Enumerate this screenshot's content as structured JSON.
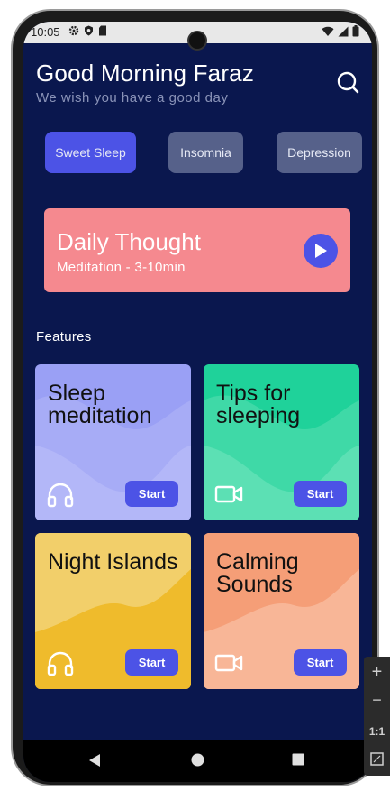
{
  "status_bar": {
    "time": "10:05"
  },
  "header": {
    "greeting": "Good Morning Faraz",
    "subtitle": "We wish you have a good day"
  },
  "chips": [
    {
      "label": "Sweet Sleep",
      "active": true
    },
    {
      "label": "Insomnia",
      "active": false
    },
    {
      "label": "Depression",
      "active": false
    }
  ],
  "daily_thought": {
    "title": "Daily Thought",
    "subtitle": "Meditation - 3-10min"
  },
  "features": {
    "title": "Features",
    "cards": [
      {
        "title": "Sleep meditation",
        "icon": "headphones-icon",
        "button": "Start",
        "color": "#9aa0f5"
      },
      {
        "title": "Tips for sleeping",
        "icon": "video-icon",
        "button": "Start",
        "color": "#23d49a"
      },
      {
        "title": "Night Islands",
        "icon": "headphones-icon",
        "button": "Start",
        "color": "#f0c23a"
      },
      {
        "title": "Calming Sounds",
        "icon": "video-icon",
        "button": "Start",
        "color": "#f6a580"
      }
    ]
  },
  "emulator_zoom": {
    "plus": "+",
    "minus": "−",
    "ratio": "1:1"
  }
}
